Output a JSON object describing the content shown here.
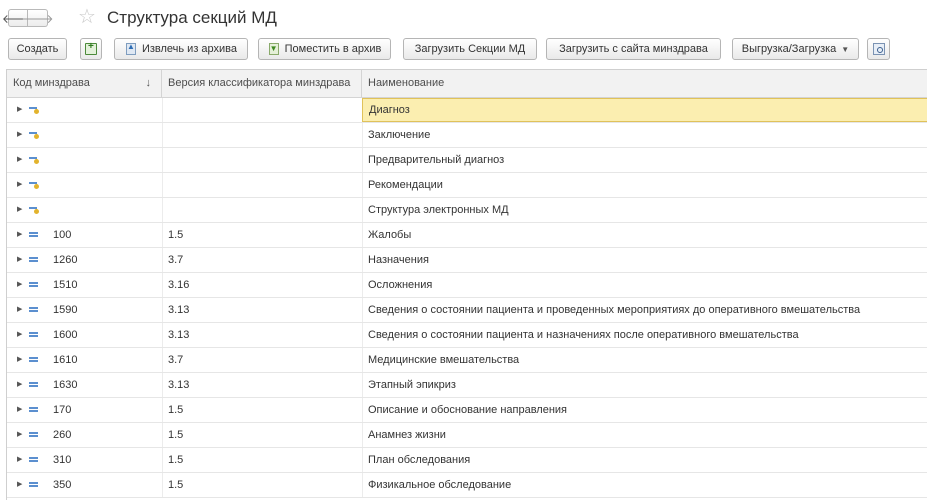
{
  "window": {
    "title": "Структура секций МД"
  },
  "nav": {
    "back_icon": "arrow-left-icon",
    "forward_icon": "arrow-right-icon",
    "favorite_icon": "star-icon"
  },
  "toolbar": {
    "create": "Создать",
    "copy_icon": "copy-add-icon",
    "extract": "Извлечь из архива",
    "archive": "Поместить в архив",
    "load_sections": "Загрузить Секции МД",
    "load_site": "Загрузить с сайта минздрава",
    "export_import": "Выгрузка/Загрузка",
    "find_icon": "search-list-icon"
  },
  "table": {
    "columns": [
      "Код минздрава",
      "Версия классификатора минздрава",
      "Наименование"
    ],
    "sort_indicator": "↓",
    "rows": [
      {
        "code": "",
        "version": "",
        "name": "Диагноз",
        "kind": "folder",
        "selected": true
      },
      {
        "code": "",
        "version": "",
        "name": "Заключение",
        "kind": "folder"
      },
      {
        "code": "",
        "version": "",
        "name": "Предварительный диагноз",
        "kind": "folder"
      },
      {
        "code": "",
        "version": "",
        "name": "Рекомендации",
        "kind": "folder"
      },
      {
        "code": "",
        "version": "",
        "name": "Структура электронных МД",
        "kind": "folder"
      },
      {
        "code": "100",
        "version": "1.5",
        "name": "Жалобы",
        "kind": "item"
      },
      {
        "code": "1260",
        "version": "3.7",
        "name": "Назначения",
        "kind": "item"
      },
      {
        "code": "1510",
        "version": "3.16",
        "name": "Осложнения",
        "kind": "item"
      },
      {
        "code": "1590",
        "version": "3.13",
        "name": "Сведения о состоянии пациента и проведенных мероприятиях до оперативного вмешательства",
        "kind": "item"
      },
      {
        "code": "1600",
        "version": "3.13",
        "name": "Сведения о состоянии пациента и назначениях после оперативного вмешательства",
        "kind": "item"
      },
      {
        "code": "1610",
        "version": "3.7",
        "name": "Медицинские вмешательства",
        "kind": "item"
      },
      {
        "code": "1630",
        "version": "3.13",
        "name": "Этапный эпикриз",
        "kind": "item"
      },
      {
        "code": "170",
        "version": "1.5",
        "name": "Описание и обоснование направления",
        "kind": "item"
      },
      {
        "code": "260",
        "version": "1.5",
        "name": "Анамнез жизни",
        "kind": "item"
      },
      {
        "code": "310",
        "version": "1.5",
        "name": "План обследования",
        "kind": "item"
      },
      {
        "code": "350",
        "version": "1.5",
        "name": "Физикальное обследование",
        "kind": "item"
      }
    ]
  },
  "colors": {
    "selected_bg": "#fbeeb0",
    "selected_border": "#e0c25a",
    "accent": "#5b8fcf"
  }
}
